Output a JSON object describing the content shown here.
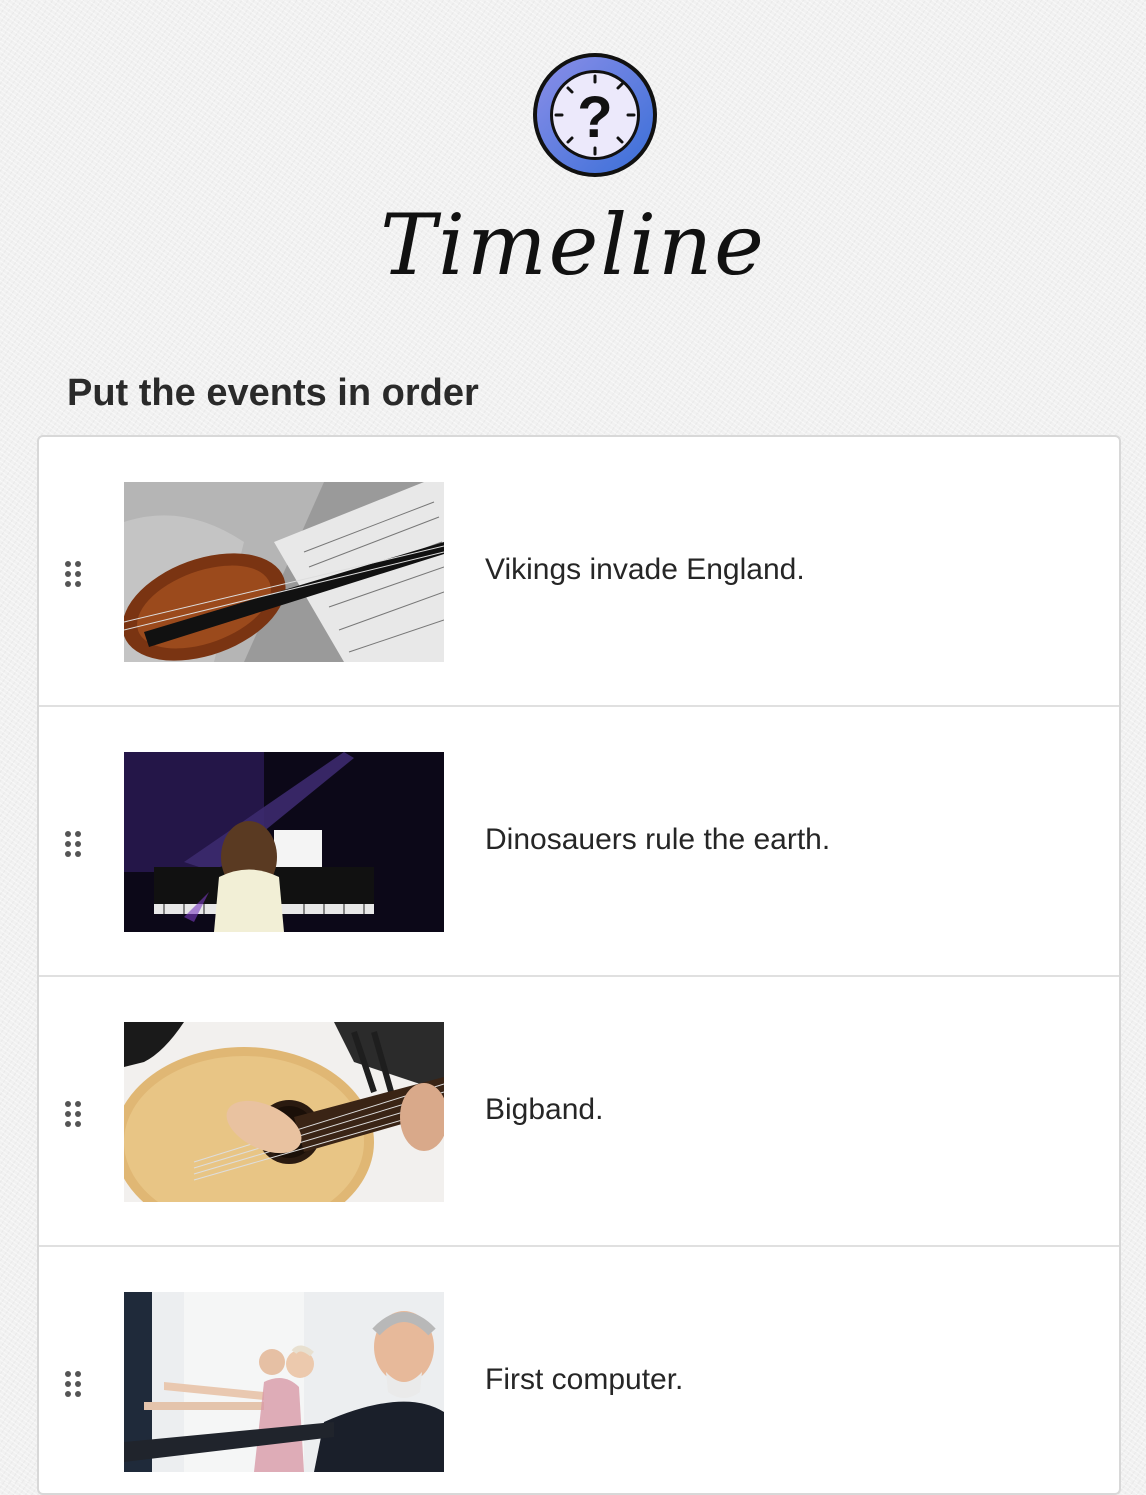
{
  "header": {
    "icon": "question-clock-icon",
    "title": "Timeline"
  },
  "instruction": "Put the events in order",
  "items": [
    {
      "label": "Vikings invade England.",
      "image": "violin-sheet-music-photo",
      "icon": "drag-handle-icon"
    },
    {
      "label": "Dinosauers rule the earth.",
      "image": "girl-playing-piano-photo",
      "icon": "drag-handle-icon"
    },
    {
      "label": "Bigband.",
      "image": "acoustic-guitar-photo",
      "icon": "drag-handle-icon"
    },
    {
      "label": "First computer.",
      "image": "seniors-exercise-class-photo",
      "icon": "drag-handle-icon"
    }
  ],
  "colors": {
    "icon_ring_outer": "#3a6fd8",
    "icon_ring_inner": "#8a8ee8",
    "icon_face": "#ece9fb",
    "row_border": "#e0e0e0"
  }
}
